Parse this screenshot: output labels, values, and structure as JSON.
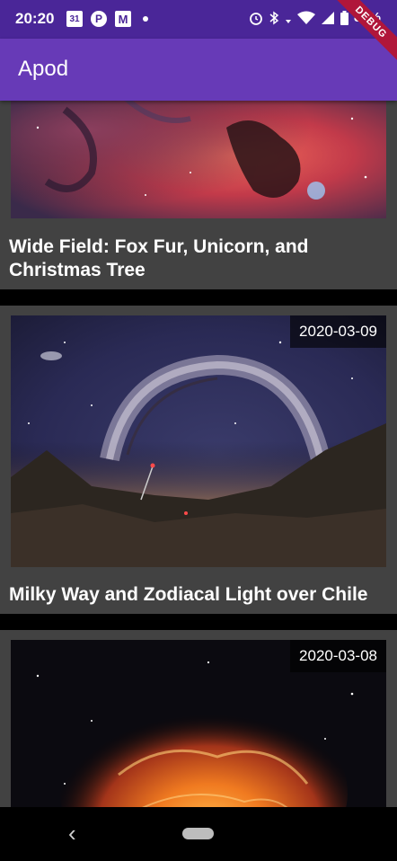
{
  "status_bar": {
    "time": "20:20",
    "calendar_day": "31",
    "battery": "83%"
  },
  "debug_banner": "DEBUG",
  "app_bar": {
    "title": "Apod"
  },
  "cards": [
    {
      "title": "Wide Field: Fox Fur, Unicorn, and Christmas Tree",
      "date": "",
      "image_subject": "red emission nebula field"
    },
    {
      "title": "Milky Way and Zodiacal Light over Chile",
      "date": "2020-03-09",
      "image_subject": "milky way arch over volcanic landscape"
    },
    {
      "title": "",
      "date": "2020-03-08",
      "image_subject": "orange crab nebula"
    }
  ],
  "nav": {
    "back_icon": "chevron-left-icon",
    "home_icon": "home-pill-icon"
  },
  "colors": {
    "status_bar": "#4a2698",
    "app_bar": "#673ab7",
    "card_bg": "#424242",
    "list_bg": "#000000"
  }
}
